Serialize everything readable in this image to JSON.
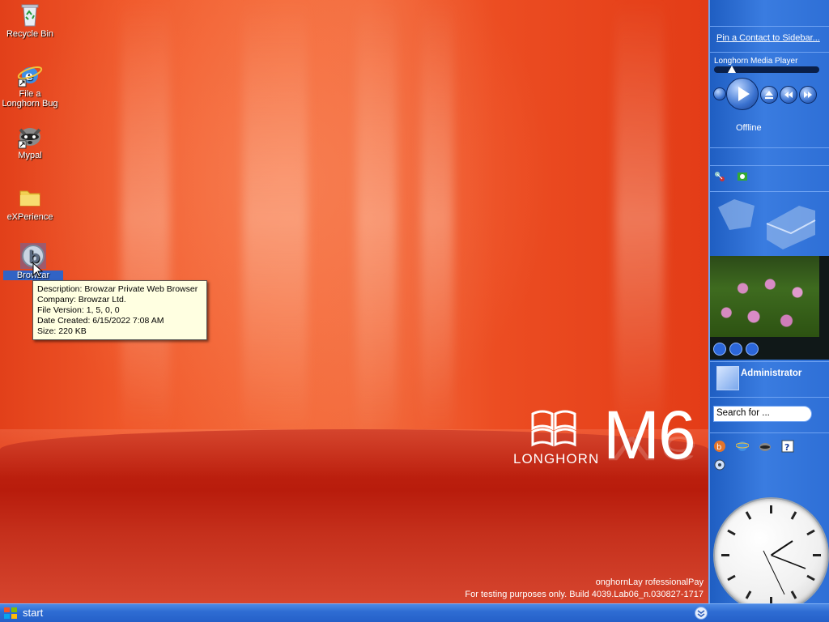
{
  "desktop": {
    "icons": [
      {
        "label": "Recycle Bin",
        "icon": "recycle-bin-icon"
      },
      {
        "label": "File a Longhorn Bug",
        "icon": "internet-explorer-icon"
      },
      {
        "label": "Mypal",
        "icon": "raccoon-icon"
      },
      {
        "label": "eXPerience",
        "icon": "folder-icon"
      },
      {
        "label": "Browzar",
        "icon": "browzar-icon"
      }
    ],
    "tooltip": {
      "description": "Description: Browzar Private Web Browser",
      "company": "Company: Browzar Ltd.",
      "version": "File Version: 1, 5, 0, 0",
      "date": "Date Created: 6/15/2022 7:08 AM",
      "size": "Size: 220 KB"
    },
    "logo": {
      "word": "LONGHORN",
      "milestone": "M6"
    },
    "build": {
      "line1": "onghornLay rofessionalPay",
      "line2": "For testing purposes only. Build 4039.Lab06_n.030827-1717"
    }
  },
  "sidebar": {
    "pin_contact": "Pin a Contact to Sidebar...",
    "media_player": {
      "title": "Longhorn Media Player",
      "status": "Offline",
      "seek_progress": 0.13
    },
    "user": {
      "name": "Administrator"
    },
    "search": {
      "placeholder": "Search for ..."
    }
  },
  "taskbar": {
    "start_label": "start"
  },
  "colors": {
    "sidebar_blue": "#2e6fd6",
    "taskbar_blue": "#245fc7",
    "wallpaper_red": "#e84a22",
    "tooltip_bg": "#ffffe1"
  }
}
